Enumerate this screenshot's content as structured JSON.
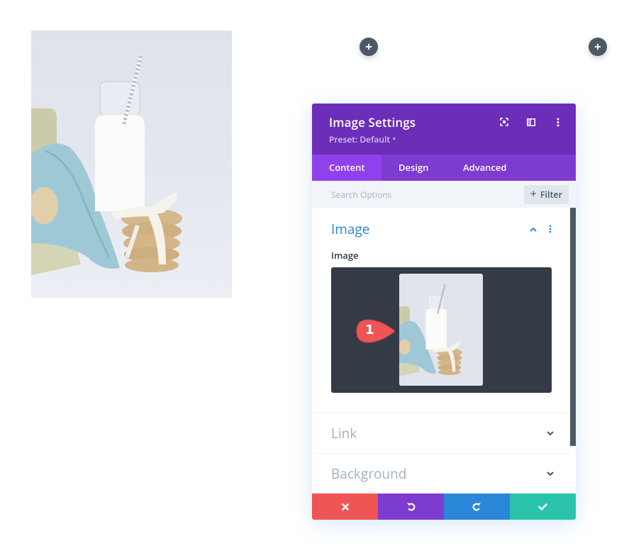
{
  "canvas": {
    "add_buttons": [
      {
        "label": "+",
        "icon": "plus-icon"
      },
      {
        "label": "+",
        "icon": "plus-icon"
      }
    ],
    "photo": {
      "subject": "milk bottle with straw, stacked cookies tied with ribbon, tin with blue tissue paper"
    }
  },
  "modal": {
    "title": "Image Settings",
    "preset_label": "Preset: Default",
    "preset_caret": "▾",
    "header_icons": [
      "expand-icon",
      "sidebar-toggle-icon",
      "more-options-icon"
    ],
    "tabs": [
      {
        "label": "Content",
        "active": true
      },
      {
        "label": "Design",
        "active": false
      },
      {
        "label": "Advanced",
        "active": false
      }
    ],
    "search": {
      "placeholder": "Search Options",
      "value": ""
    },
    "filter_button": {
      "icon": "+",
      "label": "Filter"
    },
    "sections": [
      {
        "title": "Image",
        "open": true,
        "fields": [
          {
            "label": "Image",
            "type": "image-upload"
          }
        ]
      },
      {
        "title": "Link",
        "open": false
      },
      {
        "title": "Background",
        "open": false
      }
    ],
    "annotation_badge": {
      "number": "1",
      "color": "#ef5555"
    },
    "footer": {
      "buttons": [
        {
          "name": "cancel",
          "icon": "close-icon",
          "color": "#ef5555"
        },
        {
          "name": "undo",
          "icon": "undo-icon",
          "color": "#7e3bd0"
        },
        {
          "name": "redo",
          "icon": "redo-icon",
          "color": "#2b87da"
        },
        {
          "name": "save",
          "icon": "check-icon",
          "color": "#29c4a9"
        }
      ]
    }
  },
  "colors": {
    "header_purple": "#6c2eb9",
    "tabs_purple": "#7d3bcf",
    "active_tab": "#8f42ec",
    "accent_blue": "#2b87da",
    "upload_bg": "#343b46",
    "add_button": "#4c5866"
  }
}
